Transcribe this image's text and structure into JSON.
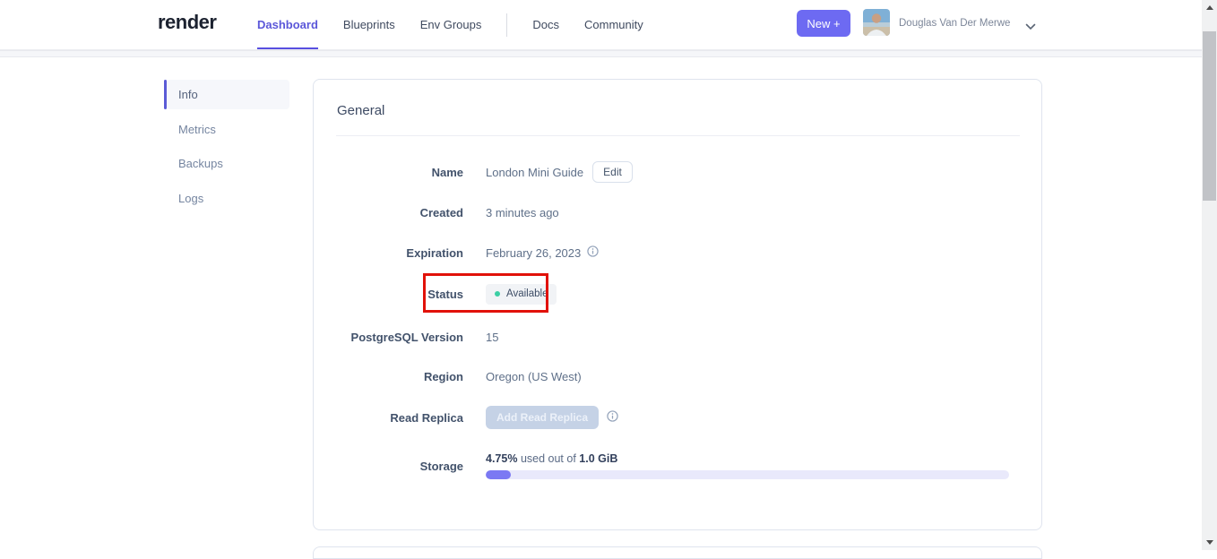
{
  "header": {
    "logo": "render",
    "nav": [
      {
        "label": "Dashboard",
        "active": true
      },
      {
        "label": "Blueprints",
        "active": false
      },
      {
        "label": "Env Groups",
        "active": false
      },
      {
        "label": "Docs",
        "active": false
      },
      {
        "label": "Community",
        "active": false
      }
    ],
    "new_button_label": "New +",
    "user_name": "Douglas Van Der Merwe"
  },
  "sidebar": {
    "items": [
      {
        "label": "Info",
        "active": true
      },
      {
        "label": "Metrics",
        "active": false
      },
      {
        "label": "Backups",
        "active": false
      },
      {
        "label": "Logs",
        "active": false
      }
    ]
  },
  "general_card": {
    "title": "General",
    "name": {
      "label": "Name",
      "value": "London Mini Guide",
      "edit_button_label": "Edit"
    },
    "created": {
      "label": "Created",
      "value": "3 minutes ago"
    },
    "expiration": {
      "label": "Expiration",
      "value": "February 26, 2023"
    },
    "status": {
      "label": "Status",
      "value": "Available"
    },
    "postgresql_version": {
      "label": "PostgreSQL Version",
      "value": "15"
    },
    "region": {
      "label": "Region",
      "value": "Oregon (US West)"
    },
    "read_replica": {
      "label": "Read Replica",
      "button_label": "Add Read Replica",
      "button_disabled": true
    },
    "storage": {
      "label": "Storage",
      "used_percent": "4.75%",
      "middle_text": "used out of",
      "total": "1.0 GiB",
      "progress_fraction": 0.0475
    }
  },
  "annotation": {
    "type": "highlight-box",
    "target": "status-row",
    "color": "#e11109"
  },
  "colors": {
    "accent_purple": "#6d6af2",
    "status_green": "#3bcfa4",
    "annotation_red": "#e11109"
  }
}
